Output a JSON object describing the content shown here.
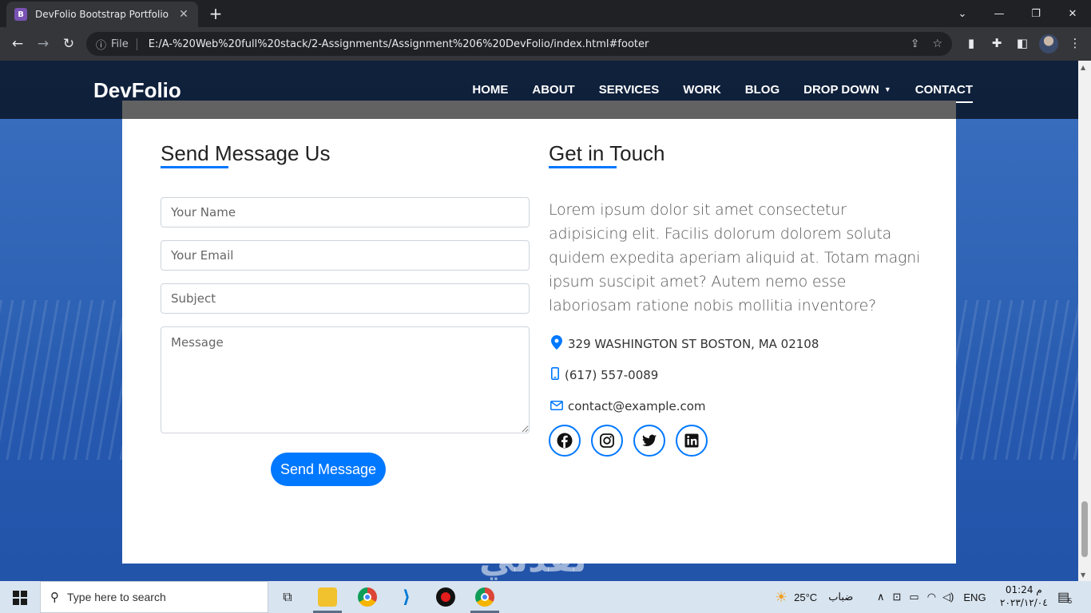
{
  "browser": {
    "tab_title": "DevFolio Bootstrap Portfolio",
    "tab_favicon": "B",
    "url_prefix": "File",
    "url": "E:/A-%20Web%20full%20stack/2-Assignments/Assignment%206%20DevFolio/index.html#footer"
  },
  "navbar": {
    "brand": "DevFolio",
    "items": [
      {
        "label": "HOME"
      },
      {
        "label": "ABOUT"
      },
      {
        "label": "SERVICES"
      },
      {
        "label": "WORK"
      },
      {
        "label": "BLOG"
      },
      {
        "label": "DROP DOWN"
      },
      {
        "label": "CONTACT"
      }
    ]
  },
  "form": {
    "title": "Send Message Us",
    "name_placeholder": "Your Name",
    "email_placeholder": "Your Email",
    "subject_placeholder": "Subject",
    "message_placeholder": "Message",
    "submit_label": "Send Message"
  },
  "contact": {
    "title": "Get in Touch",
    "lead": "Lorem ipsum dolor sit amet consectetur adipisicing elit. Facilis dolorum dolorem soluta quidem expedita aperiam aliquid at. Totam magni ipsum suscipit amet? Autem nemo esse laboriosam ratione nobis mollitia inventore?",
    "address": "329 WASHINGTON ST BOSTON, MA 02108",
    "phone": "(617) 557-0089",
    "email": "contact@example.com",
    "accent_color": "#0078ff"
  },
  "watermark": "نفذلي",
  "taskbar": {
    "search_placeholder": "Type here to search",
    "weather_temp": "25°C",
    "weather_desc": "ضباب",
    "language": "ENG",
    "time": "01:24 م",
    "date": "٢٠٢٣/١٢/٠٤",
    "notification_count": "5"
  }
}
